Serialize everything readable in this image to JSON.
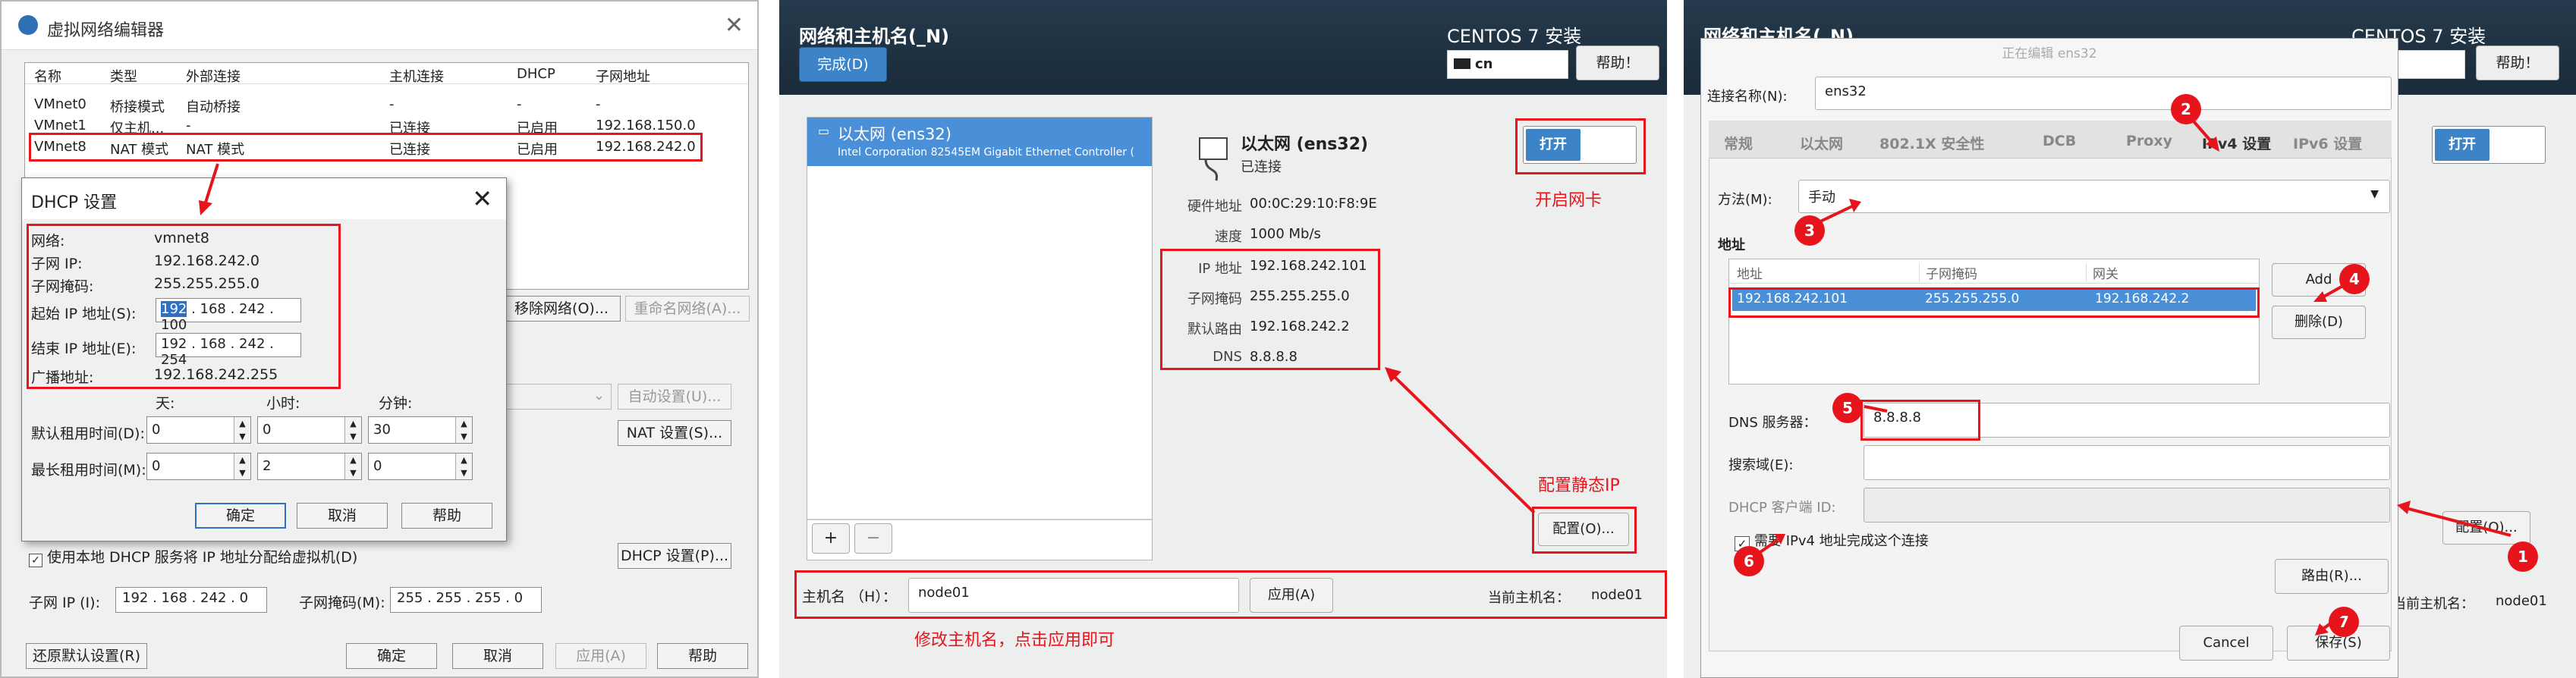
{
  "panel1": {
    "title": "虚拟网络编辑器",
    "columns": [
      "名称",
      "类型",
      "外部连接",
      "主机连接",
      "DHCP",
      "子网地址"
    ],
    "rows": [
      [
        "VMnet0",
        "桥接模式",
        "自动桥接",
        "-",
        "-",
        "-"
      ],
      [
        "VMnet1",
        "仅主机...",
        "-",
        "已连接",
        "已启用",
        "192.168.150.0"
      ],
      [
        "VMnet8",
        "NAT 模式",
        "NAT 模式",
        "已连接",
        "已启用",
        "192.168.242.0"
      ]
    ],
    "buttons_right": [
      "移除网络(O)...",
      "重命名网络(A)..."
    ],
    "auto_settings": "自动设置(U)...",
    "nat_settings": "NAT 设置(S)...",
    "dhcp_checkbox": "使用本地 DHCP 服务将 IP 地址分配给虚拟机(D)",
    "dhcp_settings": "DHCP 设置(P)...",
    "subnet_ip_label": "子网 IP (I):",
    "subnet_ip": "192 . 168 . 242 .  0",
    "subnet_mask_label": "子网掩码(M):",
    "subnet_mask": "255 . 255 . 255 .  0",
    "restore": "还原默认设置(R)",
    "ok": "确定",
    "cancel": "取消",
    "apply": "应用(A)",
    "help": "帮助"
  },
  "dhcp": {
    "title": "DHCP 设置",
    "network_label": "网络:",
    "network": "vmnet8",
    "subnet_ip_label": "子网 IP:",
    "subnet_ip": "192.168.242.0",
    "subnet_mask_label": "子网掩码:",
    "subnet_mask": "255.255.255.0",
    "start_label": "起始 IP 地址(S):",
    "start_sel": "192",
    "start_rest": " . 168 . 242 . 100",
    "end_label": "结束 IP 地址(E):",
    "end": "192 . 168 . 242 . 254",
    "broadcast_label": "广播地址:",
    "broadcast": "192.168.242.255",
    "col_day": "天:",
    "col_hour": "小时:",
    "col_min": "分钟:",
    "default_lease_label": "默认租用时间(D):",
    "default_lease": [
      "0",
      "0",
      "30"
    ],
    "max_lease_label": "最长租用时间(M):",
    "max_lease": [
      "0",
      "2",
      "0"
    ],
    "ok": "确定",
    "cancel": "取消",
    "help": "帮助"
  },
  "panel2": {
    "title": "网络和主机名(_N)",
    "install": "CENTOS 7 安装",
    "done": "完成(D)",
    "keyboard": "cn",
    "help": "帮助！",
    "device_name": "以太网 (ens32)",
    "device_desc": "Intel Corporation 82545EM Gigabit Ethernet Controller (",
    "detail_name": "以太网 (ens32)",
    "detail_status": "已连接",
    "switch_on": "打开",
    "open_nic_note": "开启网卡",
    "hw_label": "硬件地址",
    "hw": "00:0C:29:10:F8:9E",
    "speed_label": "速度",
    "speed": "1000 Mb/s",
    "ip_label": "IP 地址",
    "ip": "192.168.242.101",
    "mask_label": "子网掩码",
    "mask": "255.255.255.0",
    "gw_label": "默认路由",
    "gw": "192.168.242.2",
    "dns_label": "DNS",
    "dns": "8.8.8.8",
    "static_note": "配置静态IP",
    "config_btn": "配置(O)...",
    "add": "+",
    "remove": "−",
    "hostname_label": "主机名 （H）：",
    "hostname": "node01",
    "apply": "应用(A)",
    "current_label": "当前主机名：",
    "current": "node01",
    "hostname_note": "修改主机名，点击应用即可"
  },
  "panel3": {
    "title": "网络和主机名(_N)",
    "install": "CENTOS 7 安装",
    "help": "帮助！",
    "keyboard_tail": "n",
    "switch_on": "打开",
    "config_btn": "配置(O)...",
    "current_label": "当前主机名：",
    "current": "node01",
    "editor_title": "正在编辑 ens32",
    "conn_name_label": "连接名称(N):",
    "conn_name": "ens32",
    "tabs": [
      "常规",
      "以太网",
      "802.1X 安全性",
      "DCB",
      "Proxy",
      "IPv4 设置",
      "IPv6 设置"
    ],
    "method_label": "方法(M):",
    "method": "手动",
    "address_section": "地址",
    "addr_cols": [
      "地址",
      "子网掩码",
      "网关"
    ],
    "addr_row": [
      "192.168.242.101",
      "255.255.255.0",
      "192.168.242.2"
    ],
    "add_btn": "Add",
    "delete_btn": "删除(D)",
    "dns_label": "DNS 服务器：",
    "dns": "8.8.8.8",
    "search_label": "搜索域(E):",
    "dhcp_id_label": "DHCP 客户端 ID:",
    "require_ipv4": "需要 IPv4 地址完成这个连接",
    "routes_btn": "路由(R)...",
    "cancel": "Cancel",
    "save": "保存(S)",
    "badges": [
      "1",
      "2",
      "3",
      "4",
      "5",
      "6",
      "7"
    ]
  },
  "colors": {
    "annotation_red": "#e8141b",
    "gnome_blue": "#3c83c8",
    "selection_blue": "#4a90d9",
    "header_dark": "#1f3243"
  }
}
